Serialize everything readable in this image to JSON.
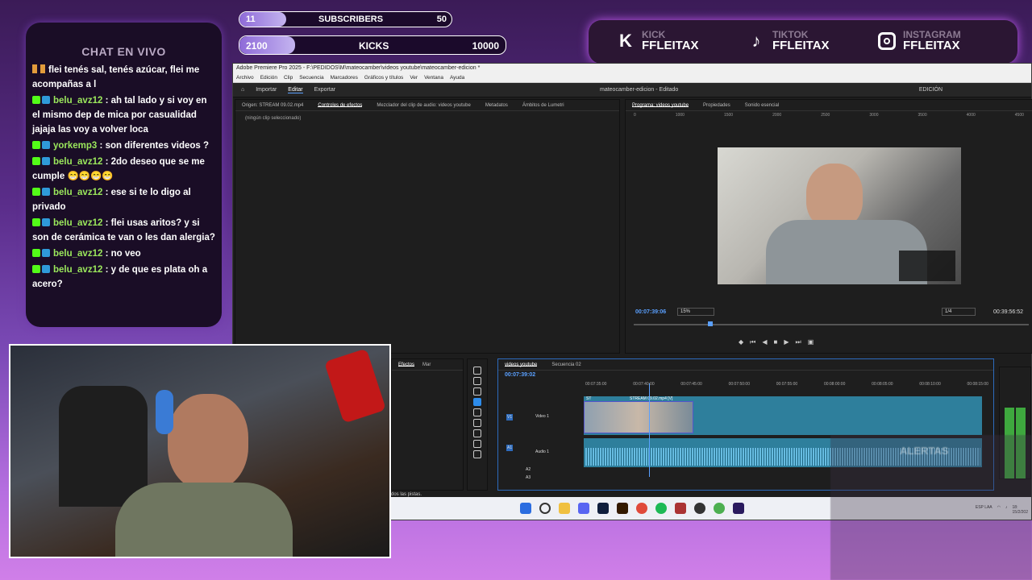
{
  "goals": {
    "subs": {
      "current": "11",
      "label": "SUBSCRIBERS",
      "target": "50",
      "progress": 0.22
    },
    "kicks": {
      "current": "2100",
      "label": "KICKS",
      "target": "10000",
      "progress": 0.21
    }
  },
  "social": [
    {
      "icon": "kick-icon",
      "platform": "KICK",
      "handle": "FFLEITAX"
    },
    {
      "icon": "tiktok-icon",
      "platform": "TIKTOK",
      "handle": "FFLEITAX"
    },
    {
      "icon": "instagram-icon",
      "platform": "INSTAGRAM",
      "handle": "FFLEITAX"
    }
  ],
  "chat": {
    "title": "CHAT EN VIVO",
    "messages": [
      {
        "user": "",
        "text": "flei tenés sal, tenés azúcar, flei me acompañas a l"
      },
      {
        "user": "belu_avz12",
        "text": ": ah tal lado y si voy en el mismo dep de mica por casualidad jajaja las voy a volver loca"
      },
      {
        "user": "yorkemp3",
        "text": ": son diferentes videos ?"
      },
      {
        "user": "belu_avz12",
        "text": ": 2do deseo que se me cumple 😁😁😁😁"
      },
      {
        "user": "belu_avz12",
        "text": ": ese si te lo digo al privado"
      },
      {
        "user": "belu_avz12",
        "text": ": flei usas aritos? y si son de cerámica te van o les dan alergia?"
      },
      {
        "user": "belu_avz12",
        "text": ": no veo"
      },
      {
        "user": "belu_avz12",
        "text": ": y de que es plata oh a acero?"
      }
    ]
  },
  "premiere": {
    "title": "Adobe Premiere Pro 2025 - F:\\PEDIDOS\\M\\mateocamber\\videos youtube\\mateocamber-edicion *",
    "menu": [
      "Archivo",
      "Edición",
      "Clip",
      "Secuencia",
      "Marcadores",
      "Gráficos y títulos",
      "Ver",
      "Ventana",
      "Ayuda"
    ],
    "workspace_tabs": [
      "Importar",
      "Editar",
      "Exportar"
    ],
    "project_title": "mateocamber-edicion - Editado",
    "edition_label": "EDICIÓN",
    "source_panel": {
      "tabs": [
        "Origen: STREAM 09.02.mp4",
        "Controles de efectos",
        "Mezclador del clip de audio: videos youtube",
        "Metadatos",
        "Ámbitos de Lumetri"
      ],
      "empty": "(ningún clip seleccionado)"
    },
    "program_panel": {
      "tabs": [
        "Programa: videos youtube",
        "Propiedades",
        "Sonido esencial"
      ],
      "ruler": [
        "0",
        "1000",
        "1500",
        "2000",
        "2500",
        "3000",
        "3500",
        "4000",
        "4500"
      ],
      "timecode": "00:07:39:06",
      "zoom": "15%",
      "resolution": "1/4",
      "duration": "00:39:56:52"
    },
    "effects_tabs": [
      "Efectos",
      "Mar"
    ],
    "timeline": {
      "tabs": [
        "videos youtube",
        "Secuencia 02"
      ],
      "timecode": "00:07:39:02",
      "ruler": [
        "00:07:35:00",
        "00:07:40:00",
        "00:07:45:00",
        "00:07:50:00",
        "00:07:55:00",
        "00:08:00:00",
        "00:08:05:00",
        "00:08:10:00",
        "00:08:15:00"
      ],
      "tracks": [
        "V1",
        "Video 1",
        "A1",
        "Audio 1",
        "A2",
        "A3"
      ],
      "clip_label": "STREAM 09.02.mp4 [V]",
      "clip_short": "ST"
    },
    "status": "dos las pistas.",
    "tray": {
      "lang": "ESP LAA",
      "time": "18:",
      "date": "15/2/202"
    }
  },
  "alertas": "ALERTAS"
}
